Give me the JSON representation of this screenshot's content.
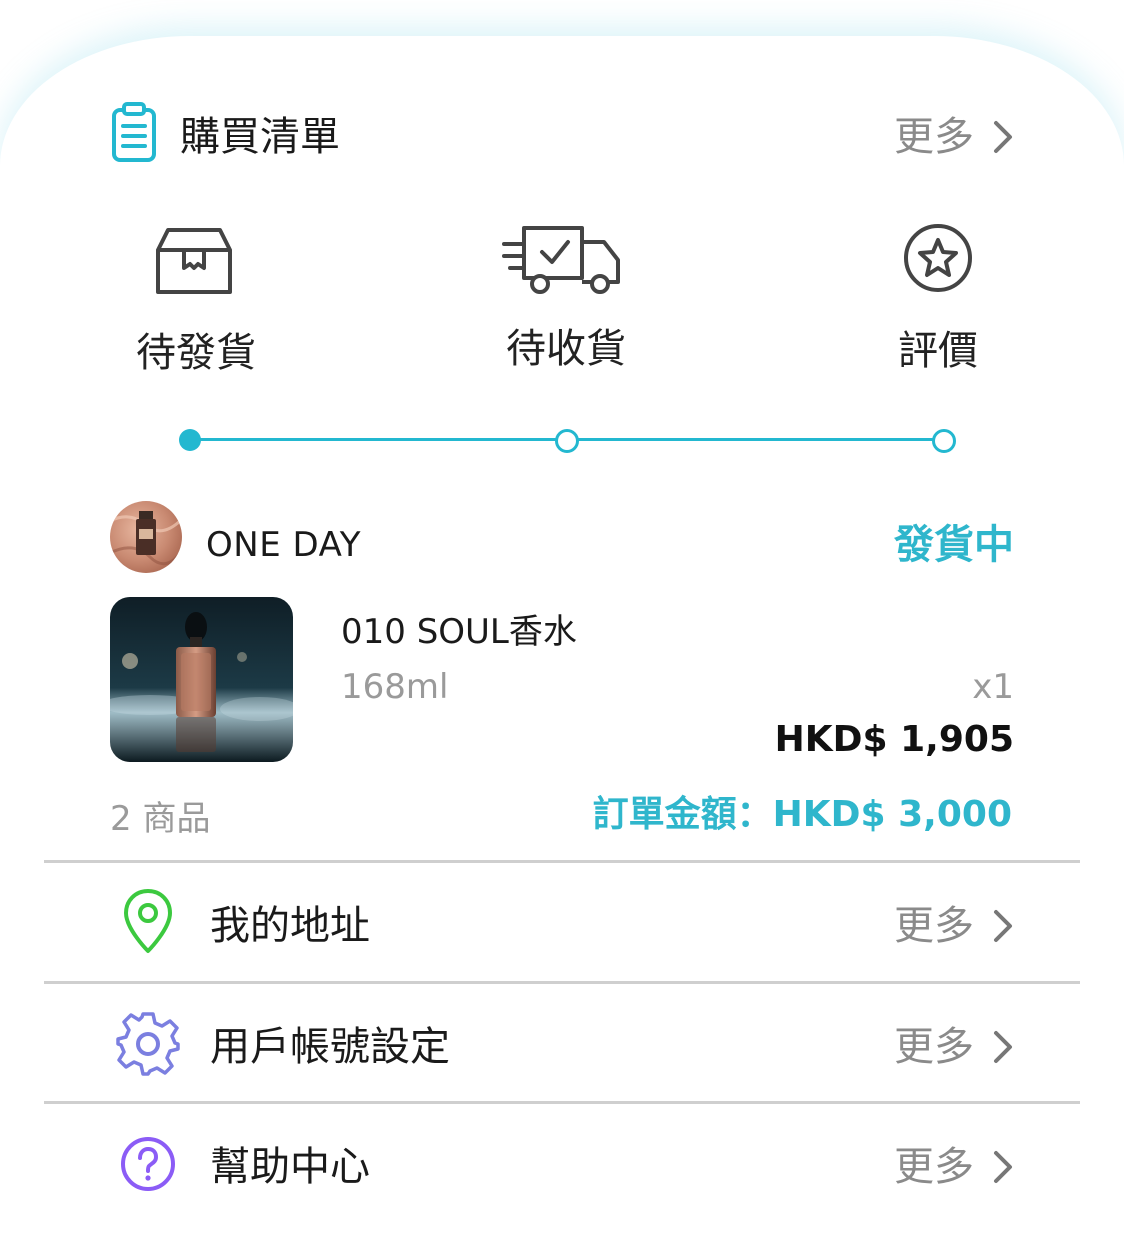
{
  "header": {
    "icon": "clipboard-icon",
    "title": "購買清單",
    "more_label": "更多"
  },
  "status_tabs": [
    {
      "icon": "box-icon",
      "label": "待發貨"
    },
    {
      "icon": "truck-icon",
      "label": "待收貨"
    },
    {
      "icon": "star-circle-icon",
      "label": "評價"
    }
  ],
  "order": {
    "store_name": "ONE DAY",
    "status": "發貨中",
    "product_name": "010 SOUL香水",
    "variant": "168ml",
    "quantity": "x1",
    "price": "HKD$ 1,905",
    "item_count": "2 商品",
    "total": "訂單金額：HKD$ 3,000"
  },
  "menu": [
    {
      "icon": "location-pin-icon",
      "label": "我的地址",
      "more_label": "更多",
      "color": "#3cc93f"
    },
    {
      "icon": "gear-icon",
      "label": "用戶帳號設定",
      "more_label": "更多",
      "color": "#7b7fe0"
    },
    {
      "icon": "question-circle-icon",
      "label": "幫助中心",
      "more_label": "更多",
      "color": "#8b5cf6"
    }
  ],
  "colors": {
    "accent": "#23b8d0",
    "status_text": "#2fb6cc",
    "muted": "#8a8a8a"
  }
}
